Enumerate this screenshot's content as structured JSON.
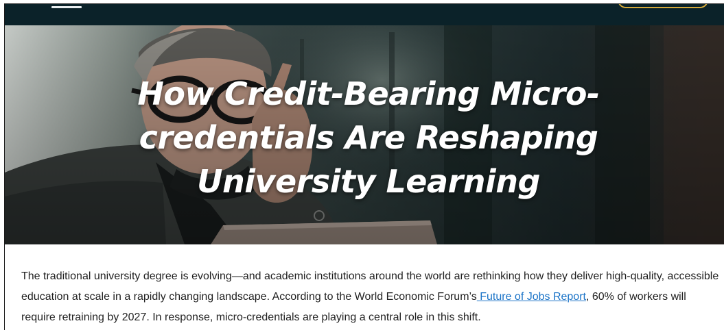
{
  "colors": {
    "topbar": "#0b2229",
    "accent_gold": "#d6a93a",
    "link": "#1a73c7",
    "body_text": "#1f1f1f",
    "hero_title": "#ffffff"
  },
  "header": {
    "menu_icon": "hamburger-menu-icon",
    "cta_button": "partially visible gold outlined button"
  },
  "hero": {
    "title": "How Credit-Bearing Micro-credentials Are Reshaping University Learning",
    "image": "man with glasses looking at laptop"
  },
  "article": {
    "text_1": "The traditional university degree is evolving—and academic institutions around the world are rethinking how they deliver high-quality, accessible education at scale in a rapidly changing landscape. According to the World Economic Forum’s",
    "link_text": " Future of Jobs Report",
    "text_2": ", 60% of workers will require retraining by 2027. In response, micro-credentials are playing a central role in this shift."
  }
}
